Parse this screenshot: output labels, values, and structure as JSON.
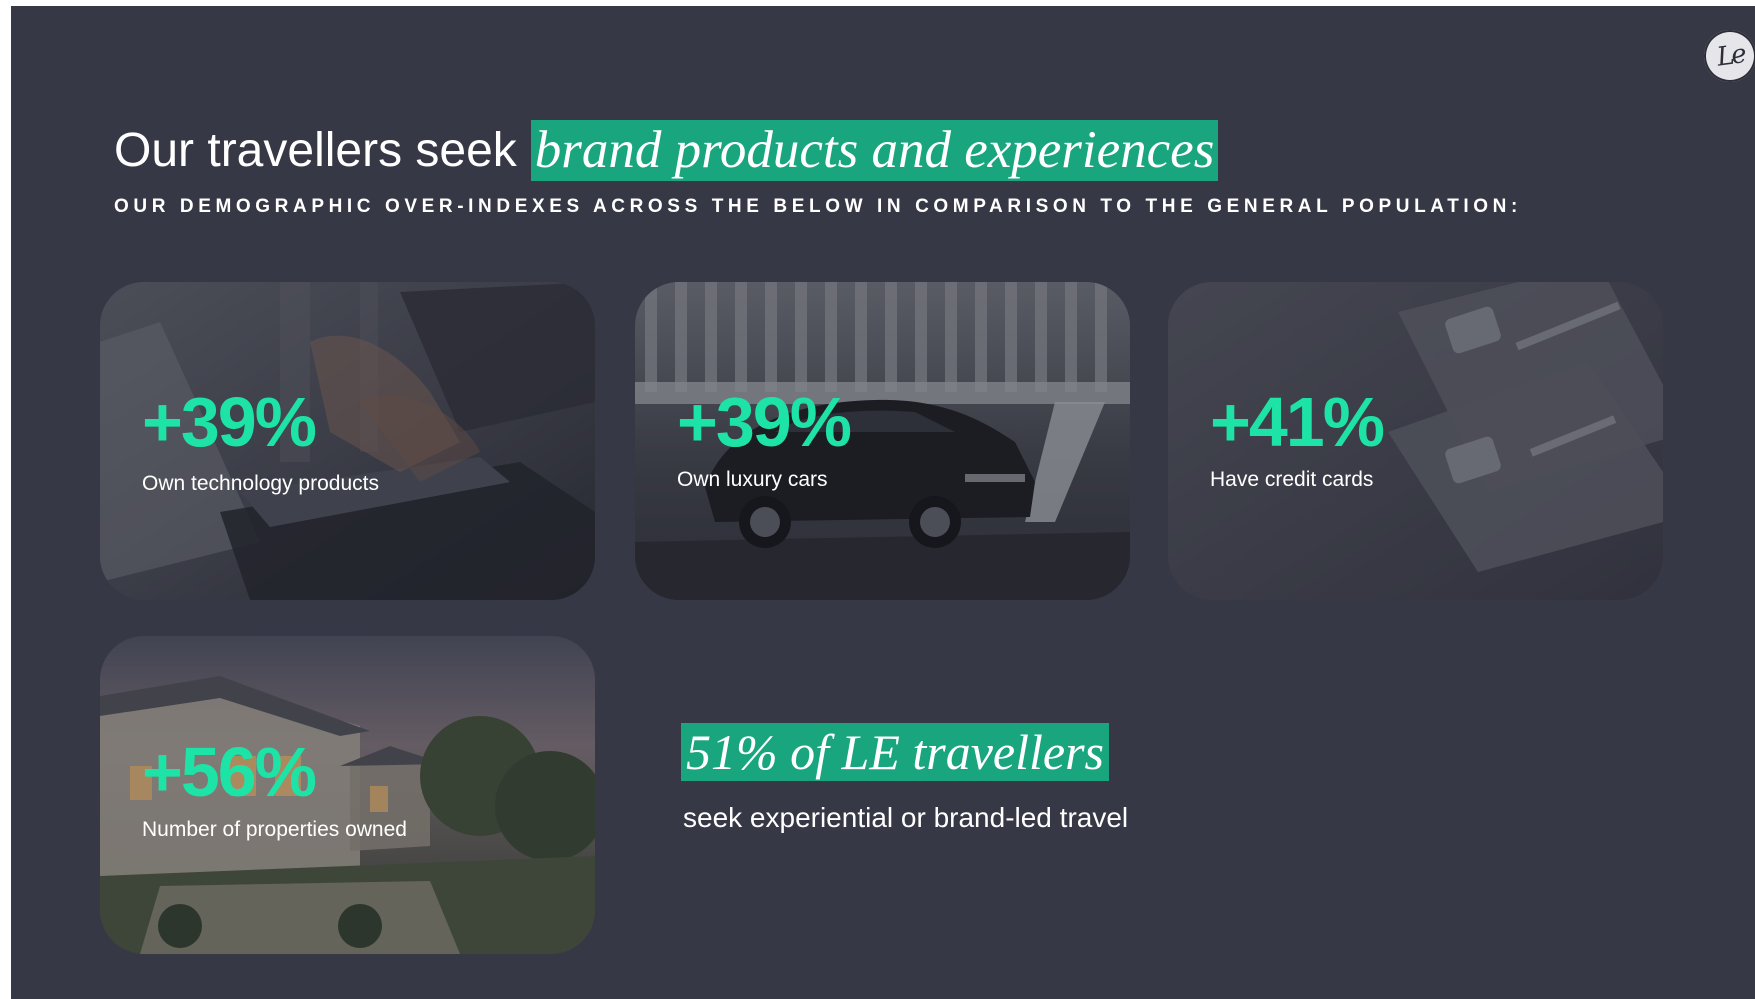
{
  "slide": {
    "title": "Our travellers seek",
    "title_highlight": "brand products and experiences",
    "subtitle": "OUR DEMOGRAPHIC OVER-INDEXES ACROSS THE BELOW IN COMPARISON TO THE GENERAL POPULATION:",
    "logo_icon": "le-monogram-icon"
  },
  "cards": [
    {
      "stat": "+39%",
      "label": "Own technology products",
      "image": "laptop-typing-image"
    },
    {
      "stat": "+39%",
      "label": "Own luxury cars",
      "image": "luxury-car-image"
    },
    {
      "stat": "+41%",
      "label": "Have credit cards",
      "image": "credit-cards-image"
    },
    {
      "stat": "+56%",
      "label": "Number of properties owned",
      "image": "house-property-image"
    }
  ],
  "callout": {
    "highlight": "51% of LE travellers",
    "text": "seek experiential or brand-led travel"
  },
  "colors": {
    "background": "#373845",
    "accent": "#19a57d",
    "stat": "#1ee3a6",
    "text": "#ffffff"
  }
}
